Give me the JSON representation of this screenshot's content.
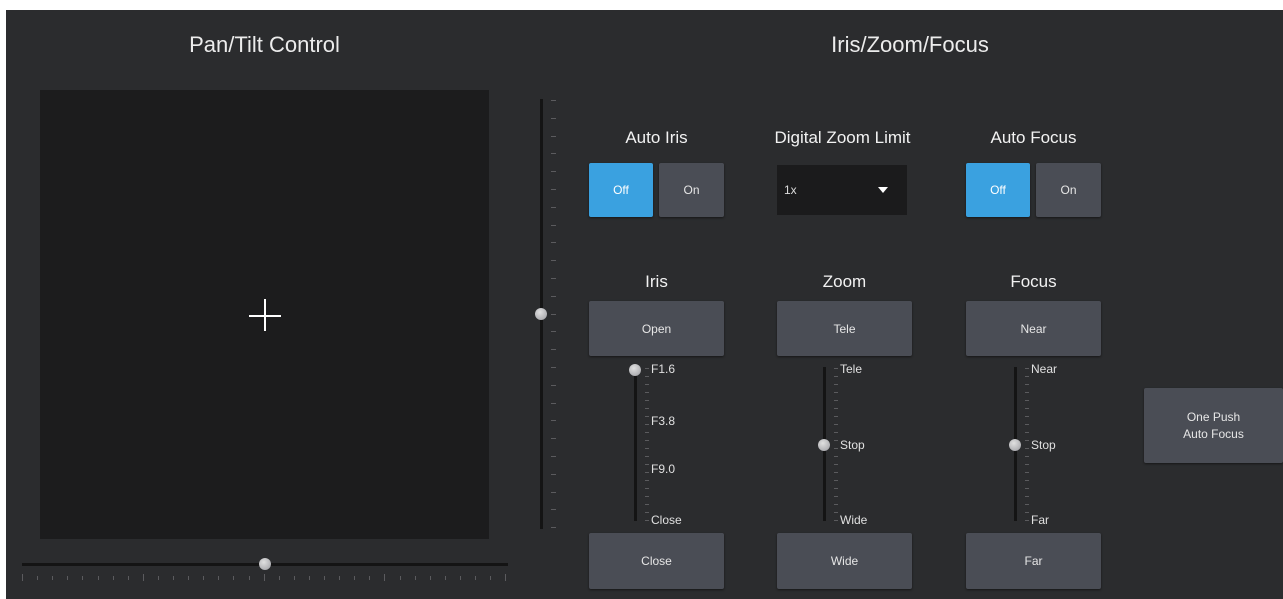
{
  "pan_tilt": {
    "title": "Pan/Tilt Control"
  },
  "iris_zoom_focus": {
    "title": "Iris/Zoom/Focus"
  },
  "auto_iris": {
    "label": "Auto Iris",
    "off": "Off",
    "on": "On",
    "selected": "Off"
  },
  "digital_zoom_limit": {
    "label": "Digital Zoom Limit",
    "value": "1x"
  },
  "auto_focus": {
    "label": "Auto Focus",
    "off": "Off",
    "on": "On",
    "selected": "Off"
  },
  "iris": {
    "label": "Iris",
    "open_button": "Open",
    "close_button": "Close",
    "scale": [
      "F1.6",
      "F3.8",
      "F9.0",
      "Close"
    ],
    "value": "F1.6"
  },
  "zoom": {
    "label": "Zoom",
    "tele_button": "Tele",
    "wide_button": "Wide",
    "scale": [
      "Tele",
      "Stop",
      "Wide"
    ],
    "value": "Stop"
  },
  "focus": {
    "label": "Focus",
    "near_button": "Near",
    "far_button": "Far",
    "scale": [
      "Near",
      "Stop",
      "Far"
    ],
    "value": "Stop"
  },
  "one_push": {
    "line1": "One Push",
    "line2": "Auto Focus"
  },
  "colors": {
    "background": "#2b2c2e",
    "button": "#4a4d55",
    "active": "#3aa1e0",
    "pad": "#1c1c1d"
  }
}
